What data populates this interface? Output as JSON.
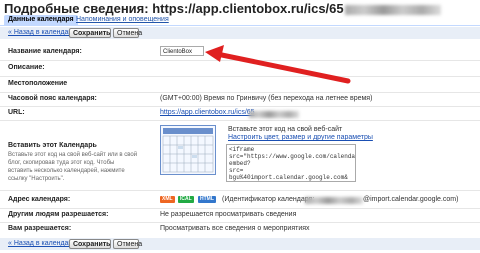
{
  "page": {
    "title_prefix": "Подробные сведения: https://app.clientobox.ru/ics/65"
  },
  "tabs": [
    {
      "label": "Данные календаря"
    },
    {
      "label": "Напоминания и оповещения"
    }
  ],
  "toolbar": {
    "back_label": "« Назад в календарь",
    "save_label": "Сохранить",
    "cancel_label": "Отмена"
  },
  "fields": {
    "name_label": "Название календаря:",
    "name_value": "ClientoBox",
    "description_label": "Описание:",
    "location_label": "Местоположение",
    "timezone_label": "Часовой пояс календаря:",
    "timezone_value": "(GMT+00:00) Время по Гринвичу (без перехода на летнее время)",
    "url_label": "URL:",
    "url_value": "https://app.clientobox.ru/ics/65",
    "embed_label": "Вставить этот Календарь",
    "embed_hint": "Вставьте этот код на свой веб-сайт или в свой блог, скопировав туда этот код. Чтобы вставить несколько календарей, нажмите ссылку \"Настроить\".",
    "embed_intro": "Вставьте этот код на свой веб-сайт",
    "embed_customize_link": "Настроить цвет, размер и другие параметры",
    "embed_code": "<iframe\nsrc=\"https://www.google.com/calendar/\nembed?\nsrc=\nbgu%40import.calendar.google.com&",
    "address_label": "Адрес календаря:",
    "address_formats": [
      "XML",
      "ICAL",
      "HTML"
    ],
    "address_value": "(Идентификатор календаря:",
    "address_suffix": "@import.calendar.google.com)",
    "others_label": "Другим людям разрешается:",
    "others_value": "Не разрешается просматривать сведения",
    "you_label": "Вам разрешается:",
    "you_value": "Просматривать все сведения о мероприятиях"
  },
  "colors": {
    "arrow": "#e02020",
    "tab_active": "#c3d9ff",
    "xml_badge": "#ee6622",
    "ical_badge": "#22aa44",
    "html_badge": "#3377cc"
  }
}
